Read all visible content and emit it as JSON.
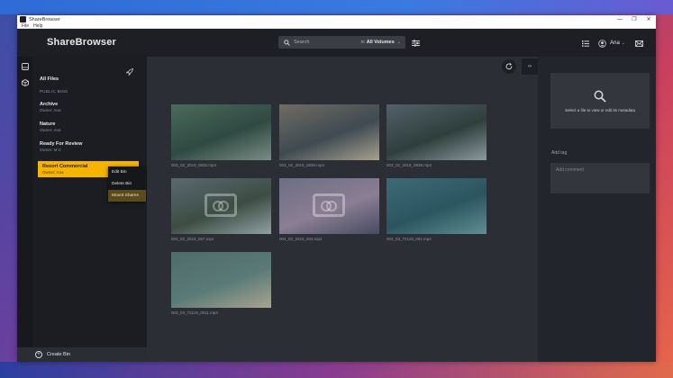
{
  "window": {
    "title": "ShareBrowser",
    "controls": [
      "—",
      "❐",
      "✕"
    ],
    "menus": [
      "File",
      "Help"
    ]
  },
  "header": {
    "logo": "ShareBrowser",
    "search": {
      "placeholder": "Search",
      "scope_prefix": "in",
      "scope": "All Volumes",
      "scope_chevron": "⌄"
    },
    "user": {
      "name": "Ana",
      "chevron": "⌄"
    }
  },
  "sidebar": {
    "all_files": "All Files",
    "section": "PUBLIC BINS",
    "bins": [
      {
        "name": "Archive",
        "owner": "Owner: Ana"
      },
      {
        "name": "Nature",
        "owner": "Owner: Ana"
      },
      {
        "name": "Ready For Review",
        "owner": "Owner: M C"
      },
      {
        "name": "Resort Commercial",
        "owner": "Owner: Ana",
        "active": true
      }
    ],
    "create_bin": "Create Bin"
  },
  "context_menu": {
    "items": [
      "Edit Bin",
      "Delete Bin",
      "Mount Shares"
    ],
    "highlighted": "Mount Shares"
  },
  "main": {
    "collapse_label": "‹›",
    "files": [
      {
        "name": "003_02_2019_0830.mp4",
        "colors": [
          "#4b6a5c",
          "#2f4a42",
          "#7a8d86"
        ],
        "placeholder": false
      },
      {
        "name": "003_02_2019_0830.mp4",
        "colors": [
          "#6f6c62",
          "#3f4a52",
          "#a7a18e"
        ],
        "placeholder": false
      },
      {
        "name": "003_02_2019_0836.mp4",
        "colors": [
          "#55606a",
          "#2e3f3b",
          "#8b9aa0"
        ],
        "placeholder": false
      },
      {
        "name": "003_02_2019_067.mp4",
        "colors": [
          "#5a6a70",
          "#3d4d44",
          "#8fa0a3"
        ],
        "placeholder": true
      },
      {
        "name": "004_02_2019_004.mp4",
        "colors": [
          "#6d6f84",
          "#8a7e93",
          "#464c60"
        ],
        "placeholder": true
      },
      {
        "name": "003_03_72119_081.mp4",
        "colors": [
          "#3e6a76",
          "#2c5560",
          "#5f8e92"
        ],
        "placeholder": false
      },
      {
        "name": "003_03_72119_0011.mp4",
        "colors": [
          "#4f6c6a",
          "#5a7a76",
          "#a8a48f"
        ],
        "placeholder": false
      }
    ]
  },
  "right_panel": {
    "meta_text": "Select a file to view or edit its metadata",
    "add_tag": "Add tag",
    "comment_placeholder": "Add comment"
  }
}
